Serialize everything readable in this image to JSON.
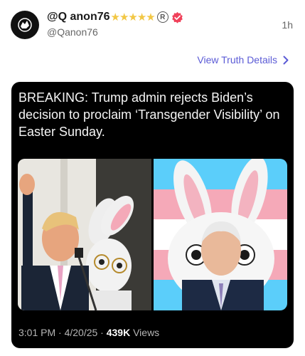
{
  "post": {
    "display_name": "@Q anon76",
    "stars": "★★★★★",
    "reg_mark": "R",
    "handle": "@Qanon76",
    "time": "1h",
    "details_link": "View Truth Details",
    "headline": "BREAKING: Trump admin rejects Biden’s decision to proclaim ‘Transgender Visibility’ on Easter Sunday.",
    "timestamp": "3:01 PM · 4/20/25 · ",
    "views_count": "439K",
    "views_label": " Views"
  },
  "colors": {
    "link": "#5b5bd6",
    "verified_badge": "#f0415a",
    "stars": "#f2c744",
    "card_bg": "#000000"
  },
  "icons": {
    "avatar": "q-logo-icon",
    "verified": "verified-badge-icon",
    "details": "chevron-right-icon"
  }
}
